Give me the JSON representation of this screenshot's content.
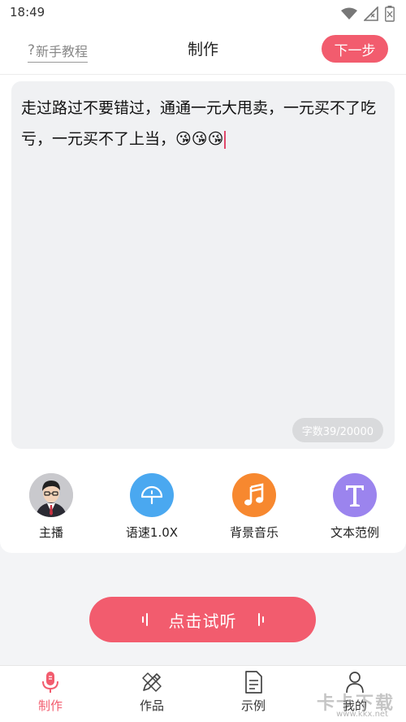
{
  "status": {
    "time": "18:49"
  },
  "header": {
    "tutorial_label": "新手教程",
    "title": "制作",
    "next_label": "下一步"
  },
  "editor": {
    "text": "走过路过不要错过，通通一元大甩卖，一元买不了吃亏，一元买不了上当，😘😘😘",
    "char_count": "字数39/20000"
  },
  "tools": [
    {
      "label": "主播",
      "icon": "avatar-icon"
    },
    {
      "label": "语速1.0X",
      "icon": "speed-gauge-icon",
      "color": "#4aa8f0"
    },
    {
      "label": "背景音乐",
      "icon": "music-note-icon",
      "color": "#f7882f"
    },
    {
      "label": "文本范例",
      "icon": "text-t-icon",
      "color": "#9b84ee"
    }
  ],
  "listen": {
    "label": "点击试听"
  },
  "tabs": [
    {
      "label": "制作",
      "icon": "microphone-icon",
      "active": true
    },
    {
      "label": "作品",
      "icon": "pencil-ruler-icon"
    },
    {
      "label": "示例",
      "icon": "document-icon"
    },
    {
      "label": "我的",
      "icon": "user-icon"
    }
  ],
  "watermark": {
    "text": "卡卡下载",
    "url": "www.kkx.net"
  },
  "colors": {
    "accent": "#f25c6e",
    "speed": "#4aa8f0",
    "music": "#f7882f",
    "text": "#9b84ee"
  }
}
